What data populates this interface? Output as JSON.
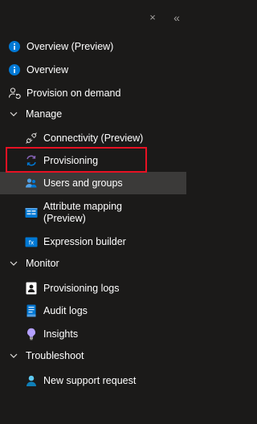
{
  "header": {
    "close_glyph": "×",
    "collapse_glyph": "«"
  },
  "nav": {
    "overview_preview": "Overview (Preview)",
    "overview": "Overview",
    "provision_on_demand": "Provision on demand",
    "manage": {
      "label": "Manage",
      "items": {
        "connectivity": "Connectivity (Preview)",
        "provisioning": "Provisioning",
        "users_and_groups": "Users and groups",
        "attribute_mapping": "Attribute mapping (Preview)",
        "expression_builder": "Expression builder"
      }
    },
    "monitor": {
      "label": "Monitor",
      "items": {
        "provisioning_logs": "Provisioning logs",
        "audit_logs": "Audit logs",
        "insights": "Insights"
      }
    },
    "troubleshoot": {
      "label": "Troubleshoot",
      "items": {
        "new_support_request": "New support request"
      }
    }
  },
  "selected_item": "Users and groups",
  "colors": {
    "background": "#1b1a19",
    "selected_bg": "#3b3a39",
    "highlight_border": "#e81123",
    "info_blue": "#0078d4"
  }
}
